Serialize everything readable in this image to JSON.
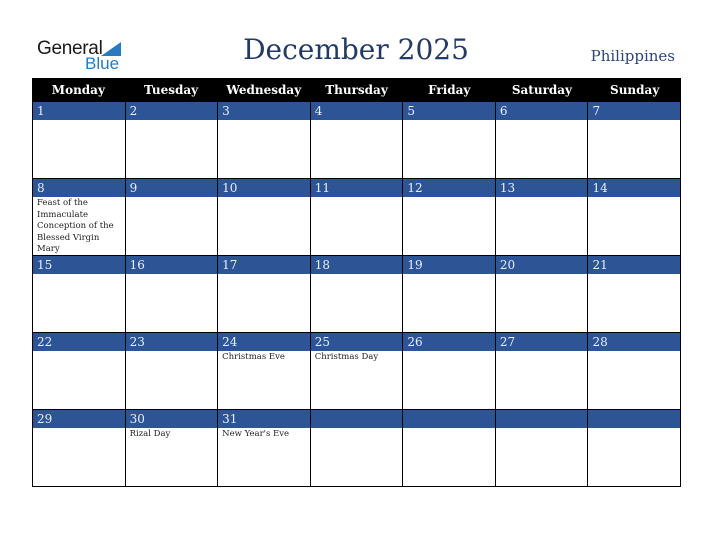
{
  "logo": {
    "general": "General",
    "blue": "Blue"
  },
  "title": "December 2025",
  "country": "Philippines",
  "weekdays": [
    "Monday",
    "Tuesday",
    "Wednesday",
    "Thursday",
    "Friday",
    "Saturday",
    "Sunday"
  ],
  "colors": {
    "header_bg": "#000000",
    "day_bar": "#2d5596",
    "title": "#233a63",
    "logo_blue": "#2a7ac0"
  },
  "weeks": [
    [
      {
        "day": "1",
        "event": ""
      },
      {
        "day": "2",
        "event": ""
      },
      {
        "day": "3",
        "event": ""
      },
      {
        "day": "4",
        "event": ""
      },
      {
        "day": "5",
        "event": ""
      },
      {
        "day": "6",
        "event": ""
      },
      {
        "day": "7",
        "event": ""
      }
    ],
    [
      {
        "day": "8",
        "event": "Feast of the Immaculate Conception of the Blessed Virgin Mary"
      },
      {
        "day": "9",
        "event": ""
      },
      {
        "day": "10",
        "event": ""
      },
      {
        "day": "11",
        "event": ""
      },
      {
        "day": "12",
        "event": ""
      },
      {
        "day": "13",
        "event": ""
      },
      {
        "day": "14",
        "event": ""
      }
    ],
    [
      {
        "day": "15",
        "event": ""
      },
      {
        "day": "16",
        "event": ""
      },
      {
        "day": "17",
        "event": ""
      },
      {
        "day": "18",
        "event": ""
      },
      {
        "day": "19",
        "event": ""
      },
      {
        "day": "20",
        "event": ""
      },
      {
        "day": "21",
        "event": ""
      }
    ],
    [
      {
        "day": "22",
        "event": ""
      },
      {
        "day": "23",
        "event": ""
      },
      {
        "day": "24",
        "event": "Christmas Eve"
      },
      {
        "day": "25",
        "event": "Christmas Day"
      },
      {
        "day": "26",
        "event": ""
      },
      {
        "day": "27",
        "event": ""
      },
      {
        "day": "28",
        "event": ""
      }
    ],
    [
      {
        "day": "29",
        "event": ""
      },
      {
        "day": "30",
        "event": "Rizal Day"
      },
      {
        "day": "31",
        "event": "New Year's Eve"
      },
      {
        "day": "",
        "event": ""
      },
      {
        "day": "",
        "event": ""
      },
      {
        "day": "",
        "event": ""
      },
      {
        "day": "",
        "event": ""
      }
    ]
  ]
}
